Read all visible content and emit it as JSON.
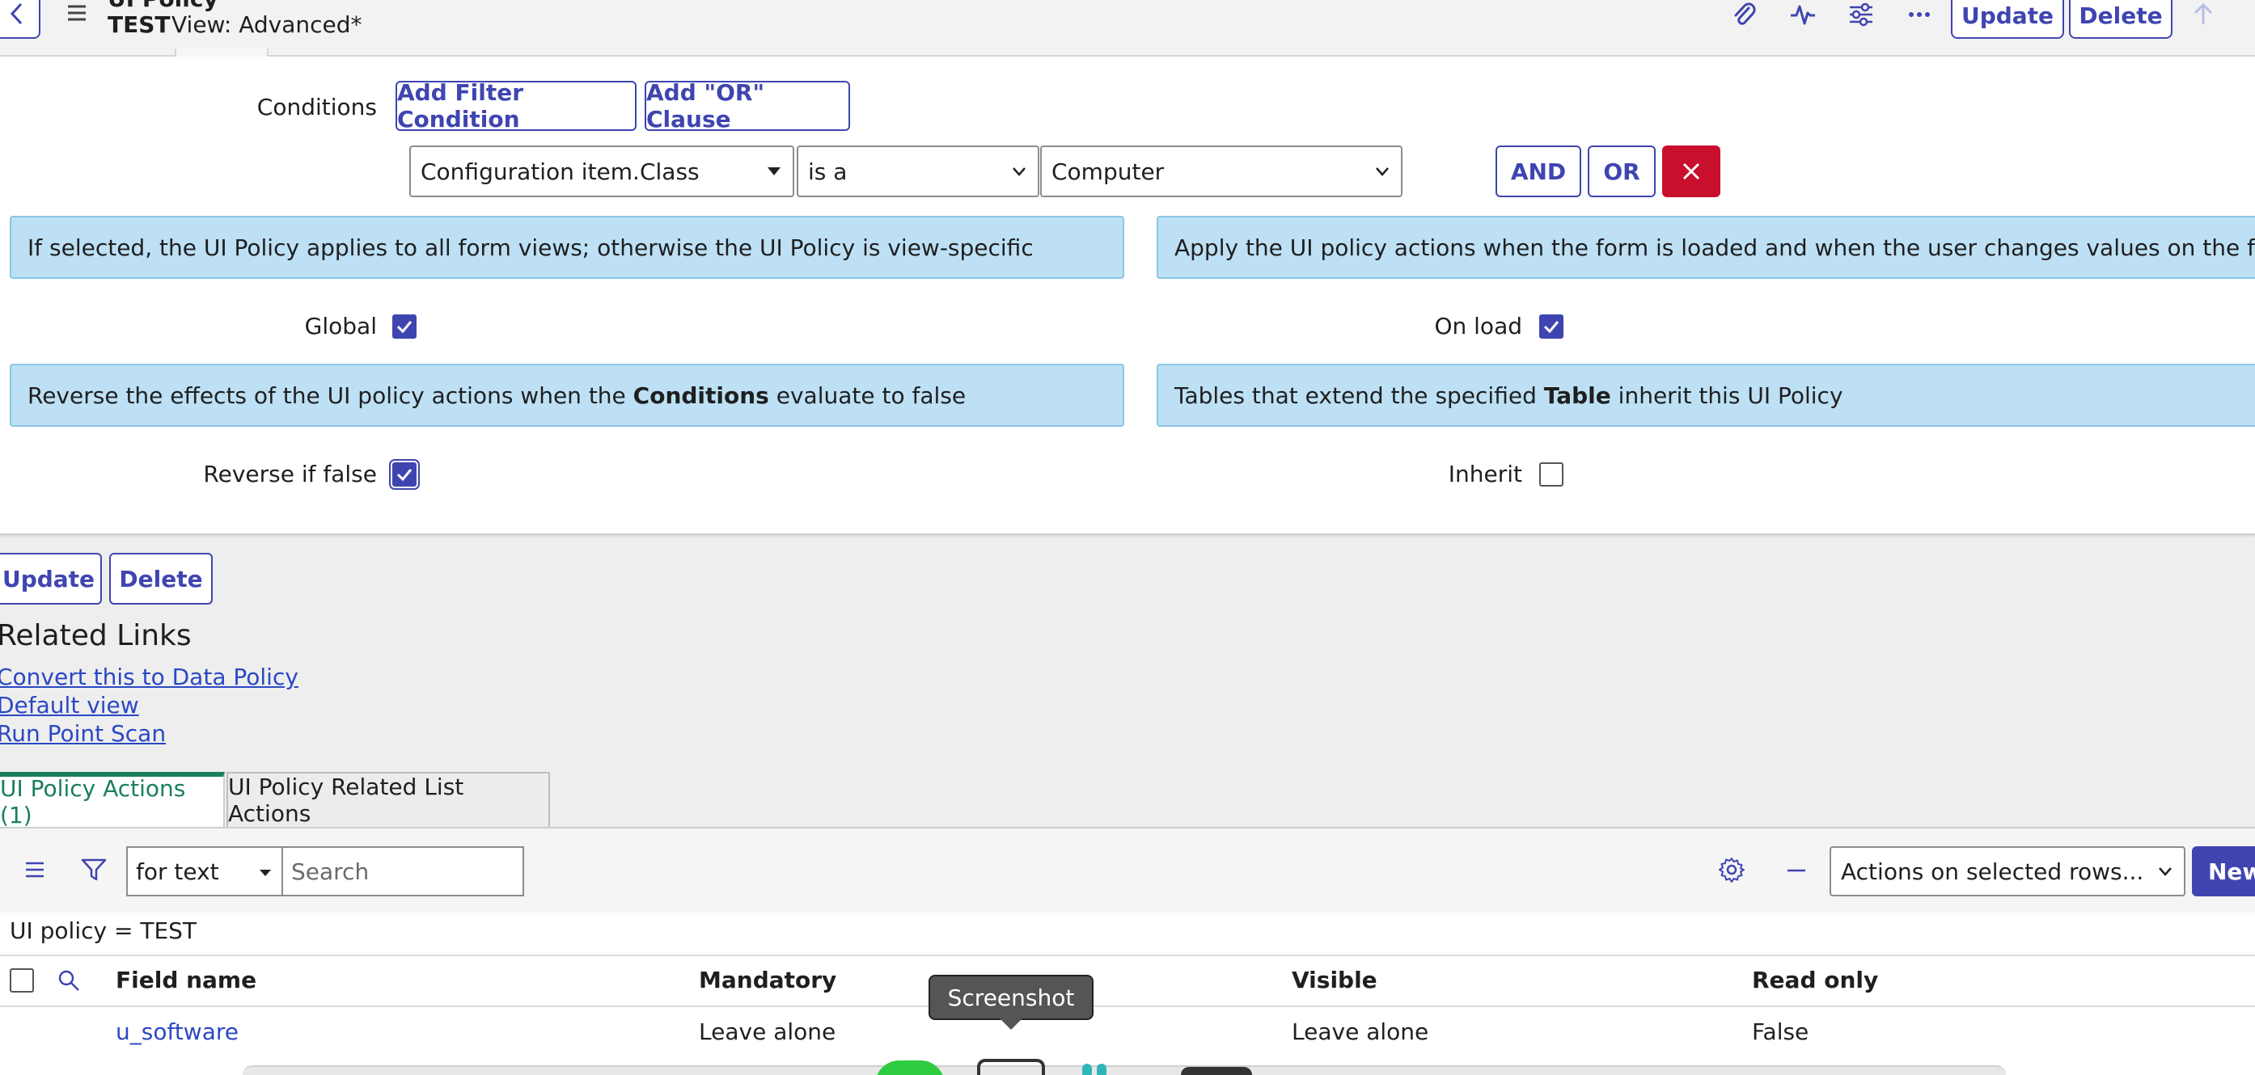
{
  "header": {
    "title_line1": "UI Policy",
    "record_name": "TEST",
    "view_label": "View: Advanced*",
    "update_label": "Update",
    "delete_label": "Delete",
    "icons": [
      "attachment-icon",
      "activity-icon",
      "settings-sliders-icon",
      "more-icon",
      "up-arrow-icon"
    ]
  },
  "conditions": {
    "label": "Conditions",
    "add_filter_label": "Add Filter Condition",
    "add_or_label": "Add \"OR\" Clause",
    "field_value": "Configuration item.Class",
    "operator_value": "is a",
    "value_value": "Computer",
    "and_label": "AND",
    "or_label": "OR"
  },
  "info": {
    "global_help": "If selected, the UI Policy applies to all form views; otherwise the UI Policy is view-specific",
    "onload_help": "Apply the UI policy actions when the form is loaded and when the user changes values on the form",
    "reverse_help_pre": "Reverse the effects of the UI policy actions when the ",
    "reverse_help_bold": "Conditions",
    "reverse_help_post": " evaluate to false",
    "inherit_help_pre": "Tables that extend the specified ",
    "inherit_help_bold": "Table",
    "inherit_help_post": " inherit this UI Policy"
  },
  "fields": {
    "global_label": "Global",
    "global_checked": true,
    "onload_label": "On load",
    "onload_checked": true,
    "reverse_label": "Reverse if false",
    "reverse_checked": true,
    "inherit_label": "Inherit",
    "inherit_checked": false
  },
  "footer_buttons": {
    "update_label": "Update",
    "delete_label": "Delete"
  },
  "related_links": {
    "title": "Related Links",
    "items": [
      "Convert this to Data Policy",
      "Default view",
      "Run Point Scan"
    ]
  },
  "tabs": [
    {
      "label": "UI Policy Actions (1)",
      "active": true
    },
    {
      "label": "UI Policy Related List Actions",
      "active": false
    }
  ],
  "list": {
    "search_field_value": "for text",
    "search_placeholder": "Search",
    "actions_select_value": "Actions on selected rows...",
    "new_label": "New",
    "breadcrumb": "UI policy = TEST",
    "columns": [
      "Field name",
      "Mandatory",
      "Visible",
      "Read only"
    ],
    "rows": [
      {
        "field_name": "u_software",
        "mandatory": "Leave alone",
        "visible": "Leave alone",
        "read_only": "False"
      }
    ]
  },
  "tooltip": {
    "text": "Screenshot"
  },
  "colors": {
    "accent": "#3f45b0",
    "danger": "#c8102e",
    "info_bg": "#bde0f5",
    "active_tab": "#1a7f5a",
    "link": "#2b48c4"
  }
}
